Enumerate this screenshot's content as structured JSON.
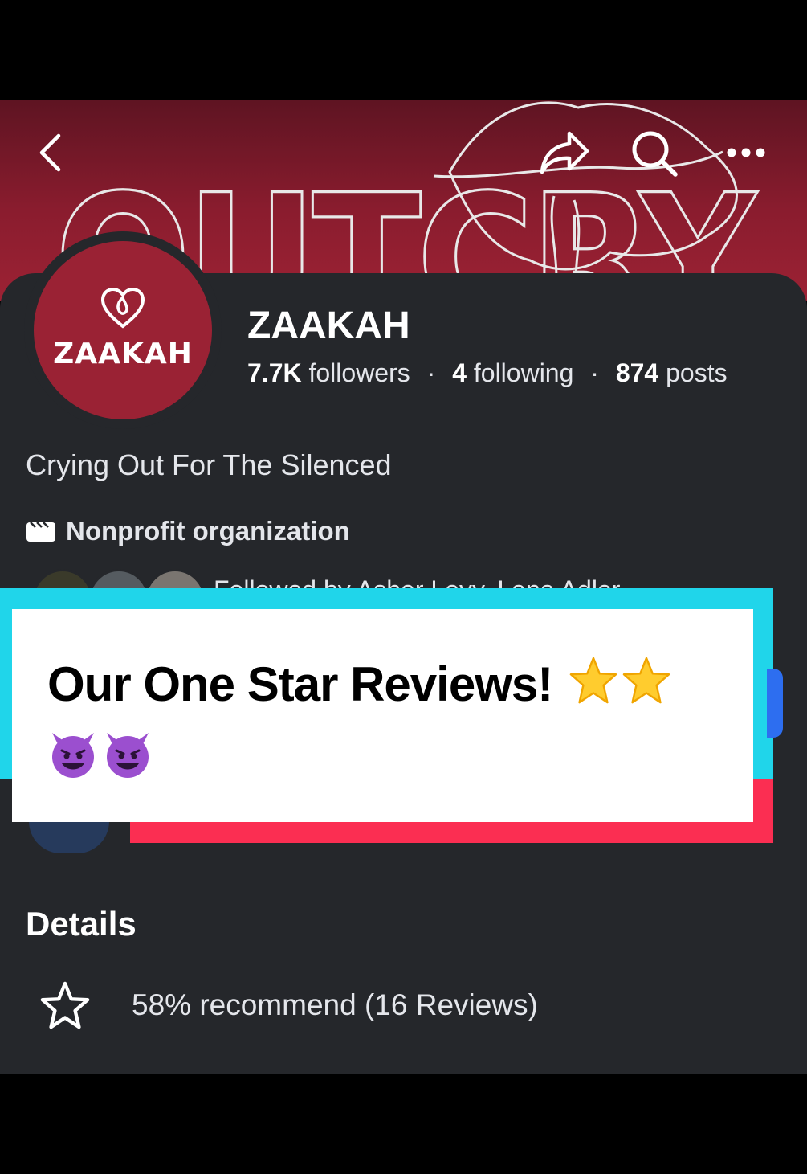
{
  "cover": {
    "banner_text": "OUTCRY",
    "colors": {
      "top": "#5e1422",
      "bottom": "#9c2234"
    }
  },
  "top_nav": {
    "back_icon": "chevron-left-icon",
    "share_icon": "share-arrow-icon",
    "search_icon": "search-icon",
    "more_icon": "more-horizontal-icon"
  },
  "profile": {
    "avatar_text": "ZAAKAH",
    "avatar_color": "#9a2234",
    "name": "ZAAKAH",
    "followers_count": "7.7K",
    "followers_label": "followers",
    "following_count": "4",
    "following_label": "following",
    "posts_count": "874",
    "posts_label": "posts",
    "separator": "·",
    "bio": "Crying Out For The Silenced",
    "category": "Nonprofit organization",
    "followed_by": "Followed by Asher Levy, Lana Adler"
  },
  "caption": {
    "text": "Our One Star Reviews!",
    "emoji": [
      "star-emoji",
      "star-emoji",
      "smiling-devil-emoji",
      "smiling-devil-emoji"
    ],
    "colors": {
      "cyan": "#20d5ea",
      "red": "#fb2e52"
    }
  },
  "details": {
    "title": "Details",
    "reviews_icon": "star-outline-icon",
    "reviews_text": "58% recommend (16 Reviews)"
  }
}
